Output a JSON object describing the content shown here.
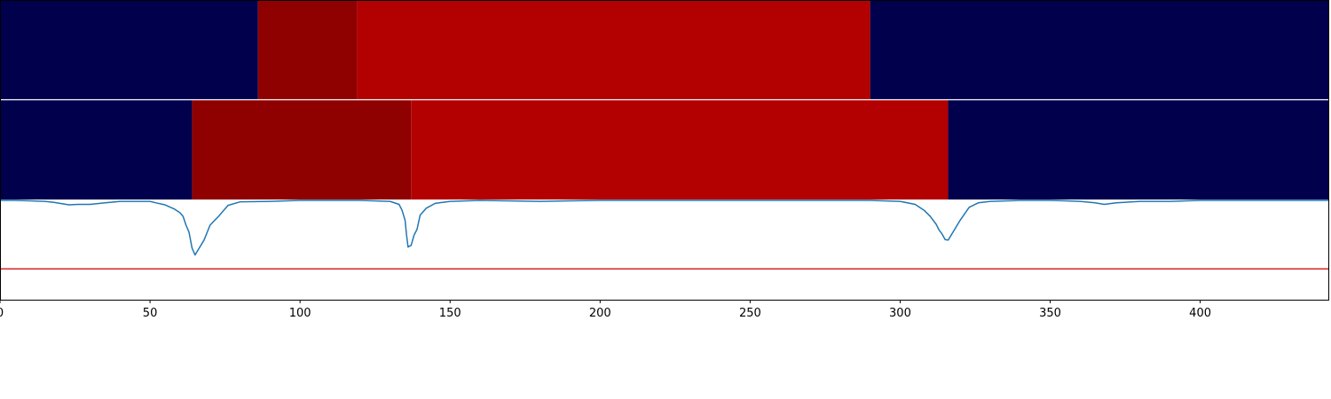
{
  "chart_data": [
    {
      "type": "heatmap",
      "colormap": "seismic",
      "xlim": [
        0,
        443
      ],
      "color_range": [
        0,
        1
      ],
      "segments": [
        {
          "start": 0,
          "end": 86,
          "value": 0.0
        },
        {
          "start": 86,
          "end": 119,
          "value": 0.97
        },
        {
          "start": 119,
          "end": 290,
          "value": 0.9
        },
        {
          "start": 290,
          "end": 443,
          "value": 0.0
        }
      ]
    },
    {
      "type": "heatmap",
      "colormap": "seismic",
      "xlim": [
        0,
        443
      ],
      "color_range": [
        0,
        1
      ],
      "segments": [
        {
          "start": 0,
          "end": 64,
          "value": 0.0
        },
        {
          "start": 64,
          "end": 137,
          "value": 0.97
        },
        {
          "start": 137,
          "end": 316,
          "value": 0.9
        },
        {
          "start": 316,
          "end": 443,
          "value": 0.0
        }
      ]
    },
    {
      "type": "line",
      "xlim": [
        0,
        443
      ],
      "ylim": [
        0.0,
        1.0
      ],
      "xticks": [
        0,
        50,
        100,
        150,
        200,
        250,
        300,
        350,
        400
      ],
      "xtick_labels": [
        "0",
        "50",
        "100",
        "150",
        "200",
        "250",
        "300",
        "350",
        "400"
      ],
      "threshold": {
        "value": 0.31,
        "color": "#d62728"
      },
      "series": [
        {
          "color": "#1f77b4",
          "x": [
            0,
            5,
            10,
            15,
            18,
            20,
            23,
            26,
            30,
            35,
            40,
            45,
            50,
            52,
            55,
            58,
            60,
            61,
            62,
            63,
            64,
            65,
            66,
            68,
            70,
            73,
            76,
            80,
            90,
            100,
            120,
            130,
            133,
            134,
            135,
            135.5,
            136,
            136.5,
            137,
            138,
            139,
            140,
            142,
            145,
            150,
            160,
            180,
            200,
            250,
            290,
            300,
            305,
            308,
            310,
            312,
            313,
            314,
            315,
            316,
            318,
            320,
            323,
            326,
            330,
            340,
            350,
            355,
            360,
            365,
            368,
            372,
            380,
            390,
            400,
            420,
            443
          ],
          "y": [
            1.0,
            1.0,
            0.995,
            0.99,
            0.98,
            0.97,
            0.955,
            0.96,
            0.96,
            0.975,
            0.99,
            0.99,
            0.99,
            0.975,
            0.955,
            0.915,
            0.875,
            0.84,
            0.75,
            0.68,
            0.52,
            0.45,
            0.5,
            0.6,
            0.75,
            0.845,
            0.95,
            0.985,
            0.99,
            1.0,
            1.0,
            0.99,
            0.96,
            0.9,
            0.8,
            0.65,
            0.53,
            0.54,
            0.545,
            0.65,
            0.71,
            0.85,
            0.92,
            0.97,
            0.99,
            1.0,
            0.99,
            1.0,
            1.0,
            1.0,
            0.99,
            0.96,
            0.9,
            0.84,
            0.76,
            0.7,
            0.66,
            0.605,
            0.6,
            0.7,
            0.8,
            0.93,
            0.975,
            0.99,
            1.0,
            1.0,
            0.995,
            0.99,
            0.975,
            0.96,
            0.975,
            0.99,
            0.99,
            1.0,
            1.0,
            1.0
          ]
        }
      ]
    }
  ]
}
